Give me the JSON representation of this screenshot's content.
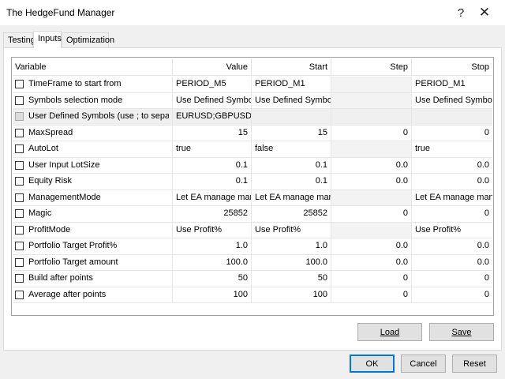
{
  "window": {
    "title": "The HedgeFund Manager",
    "help_glyph": "?",
    "close_glyph": "✕"
  },
  "tabs": [
    {
      "label": "Testing",
      "active": false
    },
    {
      "label": "Inputs",
      "active": true
    },
    {
      "label": "Optimization",
      "active": false
    }
  ],
  "grid": {
    "headers": {
      "variable": "Variable",
      "value": "Value",
      "start": "Start",
      "step": "Step",
      "stop": "Stop"
    },
    "rows": [
      {
        "variable": "TimeFrame to start from",
        "value": "PERIOD_M5",
        "start": "PERIOD_M1",
        "step": "",
        "stop": "PERIOD_M1",
        "numeric": false
      },
      {
        "variable": "Symbols selection mode",
        "value": "Use Defined Symbols",
        "start": "Use Defined Symbols",
        "step": "",
        "stop": "Use Defined Symbols",
        "numeric": false
      },
      {
        "variable": "User Defined Symbols (use ; to separate)",
        "value": "EURUSD;GBPUSD;EURJPY",
        "start": "",
        "step": "",
        "stop": "",
        "numeric": false,
        "disabled": true
      },
      {
        "variable": "MaxSpread",
        "value": "15",
        "start": "15",
        "step": "0",
        "stop": "0",
        "numeric": true
      },
      {
        "variable": "AutoLot",
        "value": "true",
        "start": "false",
        "step": "",
        "stop": "true",
        "numeric": false
      },
      {
        "variable": "User Input LotSize",
        "value": "0.1",
        "start": "0.1",
        "step": "0.0",
        "stop": "0.0",
        "numeric": true
      },
      {
        "variable": "Equity Risk",
        "value": "0.1",
        "start": "0.1",
        "step": "0.0",
        "stop": "0.0",
        "numeric": true
      },
      {
        "variable": "ManagementMode",
        "value": "Let EA manage manua...",
        "start": "Let EA manage manua...",
        "step": "",
        "stop": "Let EA manage manual...",
        "numeric": false
      },
      {
        "variable": "Magic",
        "value": "25852",
        "start": "25852",
        "step": "0",
        "stop": "0",
        "numeric": true
      },
      {
        "variable": "ProfitMode",
        "value": "Use Profit%",
        "start": "Use Profit%",
        "step": "",
        "stop": "Use Profit%",
        "numeric": false
      },
      {
        "variable": "Portfolio Target Profit%",
        "value": "1.0",
        "start": "1.0",
        "step": "0.0",
        "stop": "0.0",
        "numeric": true
      },
      {
        "variable": "Portfolio Target amount",
        "value": "100.0",
        "start": "100.0",
        "step": "0.0",
        "stop": "0.0",
        "numeric": true
      },
      {
        "variable": "Build after points",
        "value": "50",
        "start": "50",
        "step": "0",
        "stop": "0",
        "numeric": true
      },
      {
        "variable": "Average after points",
        "value": "100",
        "start": "100",
        "step": "0",
        "stop": "0",
        "numeric": true
      }
    ]
  },
  "buttons": {
    "load": {
      "label": "Load"
    },
    "save": {
      "label": "Save"
    },
    "ok": {
      "label": "OK"
    },
    "cancel": {
      "label": "Cancel"
    },
    "reset": {
      "label": "Reset"
    }
  },
  "colors": {
    "default_button_border": "#0078d7"
  }
}
